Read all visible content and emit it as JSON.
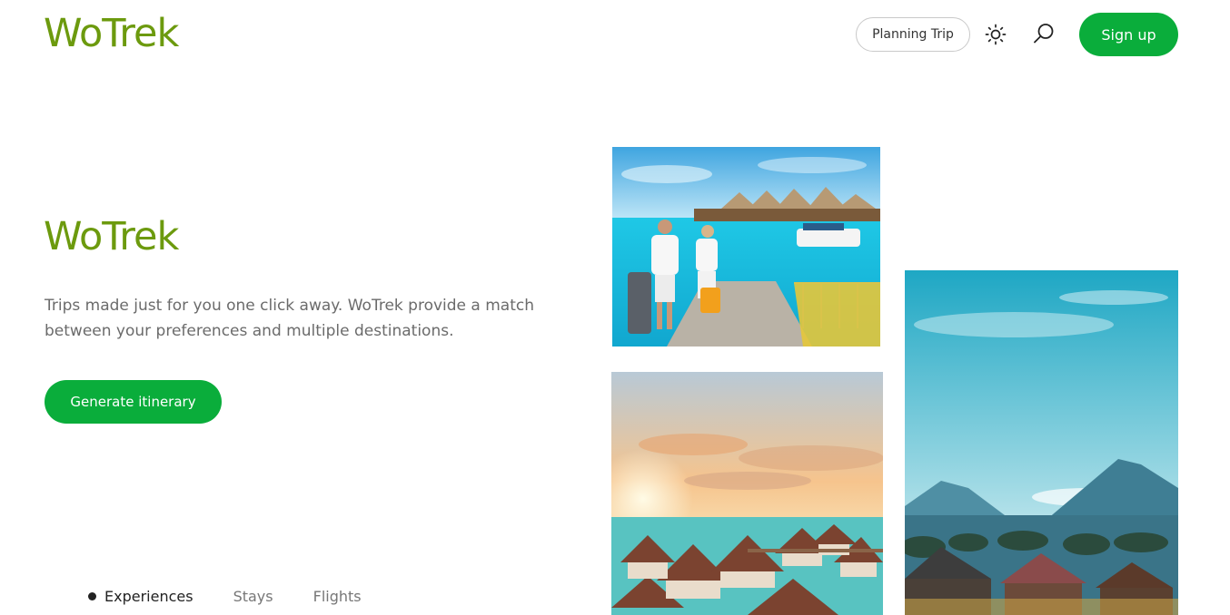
{
  "header": {
    "logo": "WoTrek",
    "planning_label": "Planning Trip",
    "theme_icon": "sun-icon",
    "search_icon": "search-icon",
    "signup_label": "Sign up"
  },
  "hero": {
    "logo": "WoTrek",
    "tagline": "Trips made just for you one click away. WoTrek provide a match between your preferences and multiple destinations.",
    "cta_label": "Generate itinerary"
  },
  "tabs": [
    {
      "label": "Experiences",
      "active": true
    },
    {
      "label": "Stays",
      "active": false
    },
    {
      "label": "Flights",
      "active": false
    }
  ],
  "colors": {
    "brand_green": "#6c9a0e",
    "button_green": "#0aad3b"
  }
}
